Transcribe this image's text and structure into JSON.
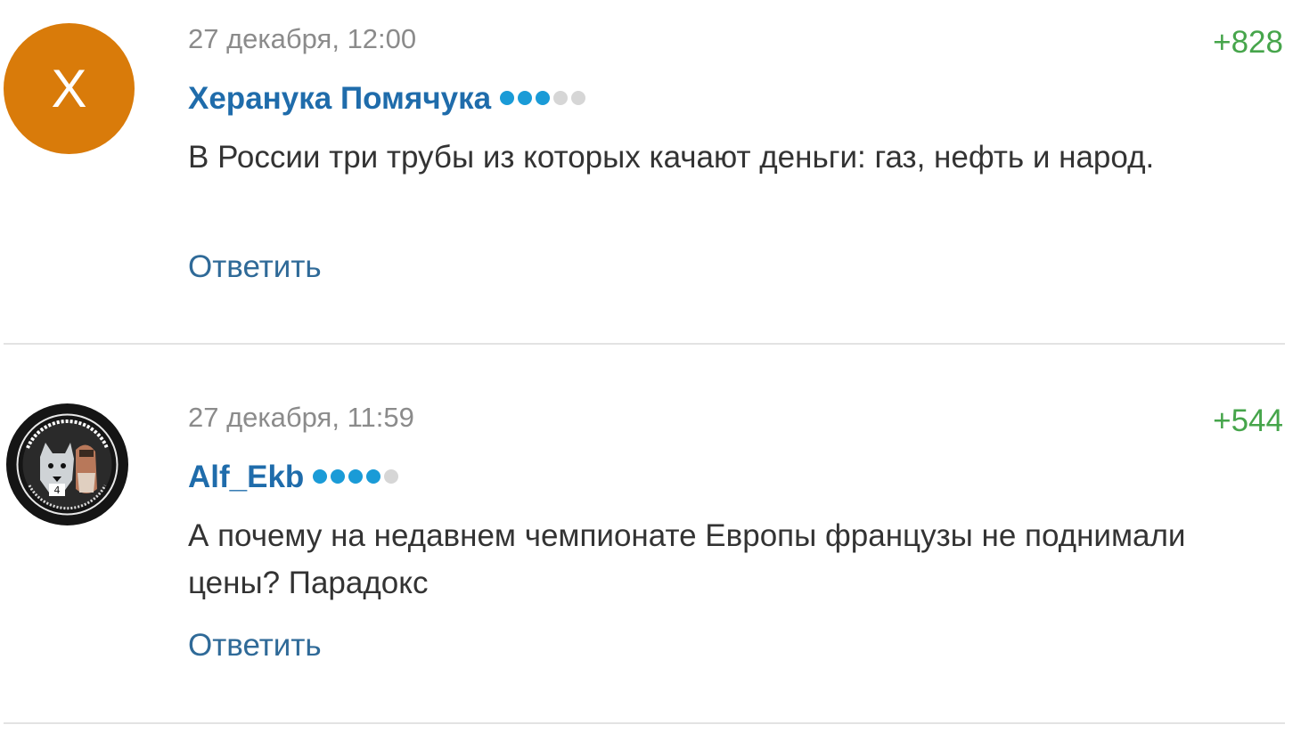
{
  "comments": [
    {
      "avatar_letter": "Х",
      "avatar_color": "#d97b0a",
      "date": "27 декабря, 12:00",
      "author": "Херанука Помячука",
      "rating": "+828",
      "level_on": 3,
      "level_total": 5,
      "text": "В России три трубы из которых качают деньги: газ, нефть и народ.",
      "reply_label": "Ответить"
    },
    {
      "avatar_icon": "dog-emblem-avatar",
      "date": "27 декабря, 11:59",
      "author": "Alf_Ekb",
      "rating": "+544",
      "level_on": 4,
      "level_total": 5,
      "text": "А почему на недавнем чемпионате Европы французы не поднимали цены? Парадокс",
      "reply_label": "Ответить"
    }
  ],
  "colors": {
    "author": "#1f6cab",
    "rating": "#46a54b",
    "reply": "#2f6a98",
    "date": "#8b8b8b",
    "level_dot_on": "#1a9bd7",
    "level_dot_off": "#d6d6d6"
  }
}
